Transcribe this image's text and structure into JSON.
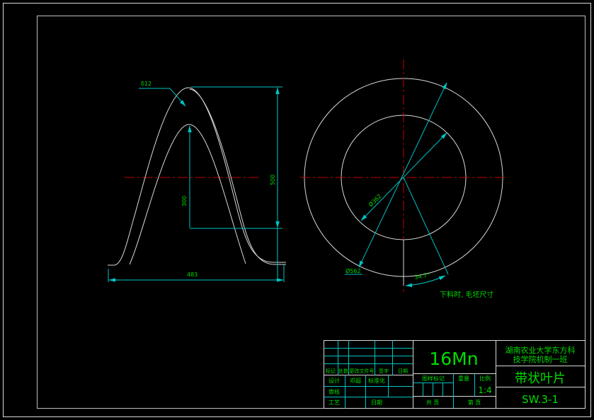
{
  "app": {
    "type": "cad-drawing",
    "background": "#000000",
    "colors": {
      "outline_white": "#d9d9d9",
      "dimension_cyan": "#00c3c3",
      "centerline_red": "#c40000",
      "text_green": "#00dc00"
    }
  },
  "left_view": {
    "thickness_label": "δ12",
    "dim_height_outer": "500",
    "dim_height_inner": "300",
    "dim_width": "483"
  },
  "right_view": {
    "dim_outer_dia": "Ø562",
    "dim_inner_dia": "Ø362",
    "dim_angle": "34.7°",
    "note": "下料时, 毛坯尺寸"
  },
  "title_block": {
    "material": "16Mn",
    "school_line1": "湖南农业大学东方科",
    "school_line2": "技学院机制一班",
    "part_name": "带状叶片",
    "drawing_no": "SW.3-1",
    "scale_value": "1:4",
    "headers": {
      "mark": "标记",
      "count": "处数",
      "change_doc": "更改文件号",
      "sign": "签字",
      "date": "日期"
    },
    "rows": {
      "design": "设计",
      "designer": "邓超",
      "standardization": "标准化",
      "review": "审核",
      "process": "工艺",
      "date": "日期"
    },
    "middle": {
      "stamp": "图样标记",
      "weight": "重量",
      "scale_label": "比例",
      "sheets_total": "共  页",
      "sheet_no": "第  页"
    }
  }
}
